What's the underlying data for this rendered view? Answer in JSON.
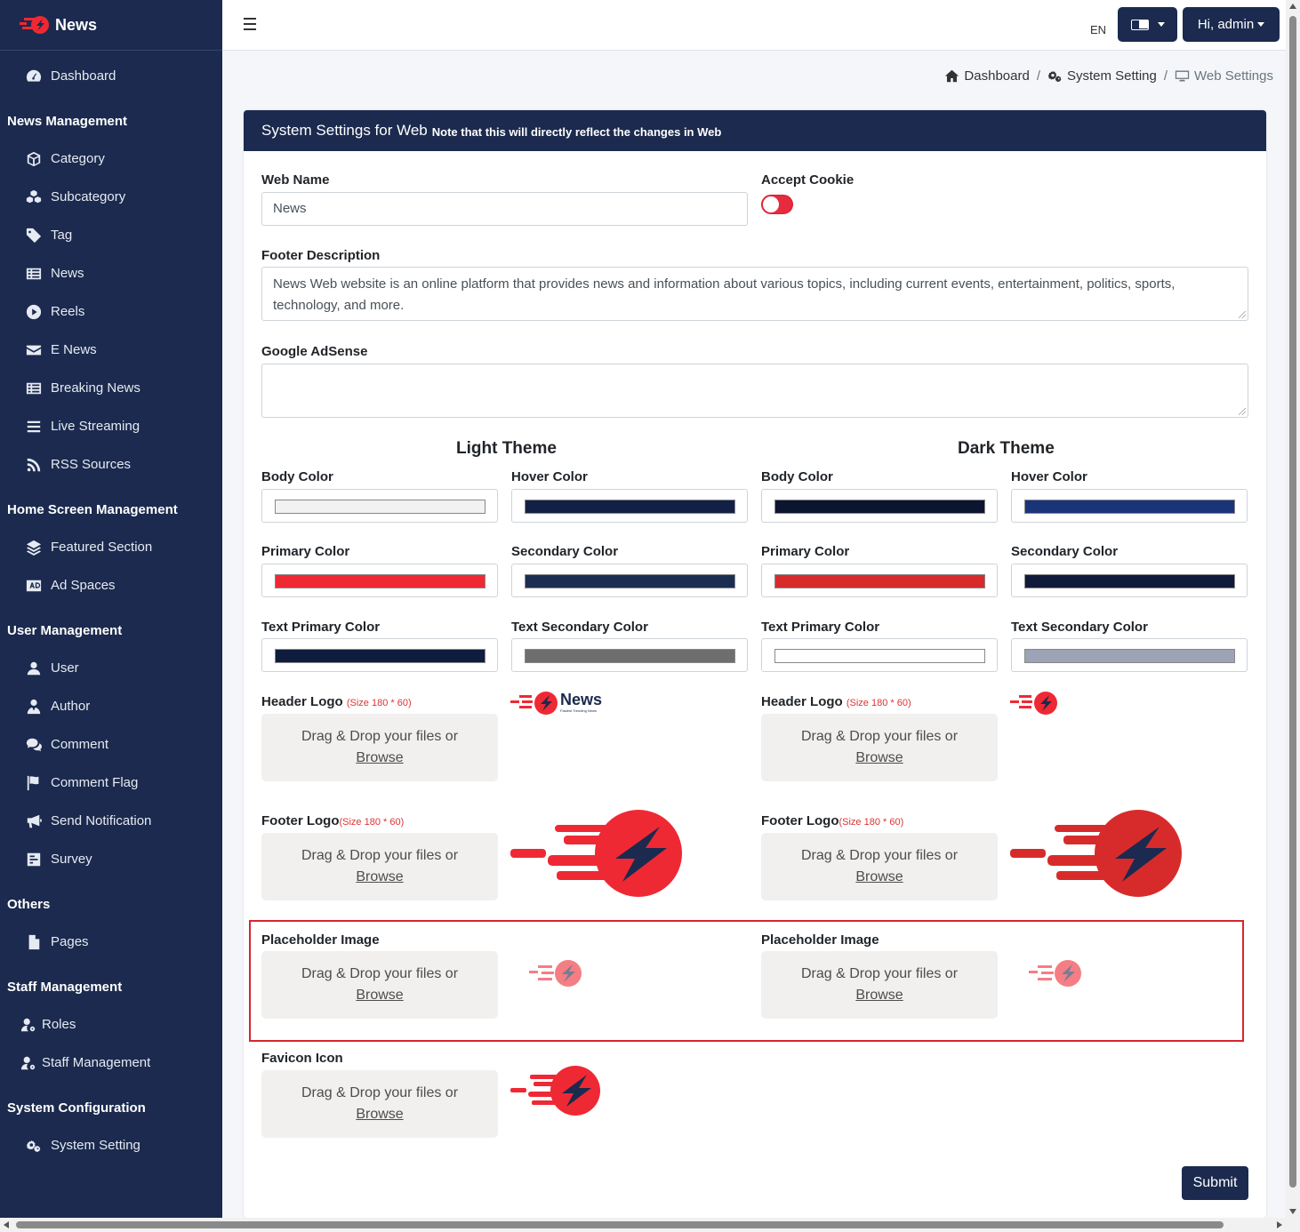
{
  "brand": {
    "name": "News"
  },
  "sidebar": {
    "dashboard": "Dashboard",
    "sections": [
      {
        "title": "News Management",
        "items": [
          "Category",
          "Subcategory",
          "Tag",
          "News",
          "Reels",
          "E News",
          "Breaking News",
          "Live Streaming",
          "RSS Sources"
        ]
      },
      {
        "title": "Home Screen Management",
        "items": [
          "Featured Section",
          "Ad Spaces"
        ]
      },
      {
        "title": "User Management",
        "items": [
          "User",
          "Author",
          "Comment",
          "Comment Flag",
          "Send Notification",
          "Survey"
        ]
      },
      {
        "title": "Others",
        "items": [
          "Pages"
        ]
      },
      {
        "title": "Staff Management",
        "items": [
          "Roles",
          "Staff Management"
        ]
      },
      {
        "title": "System Configuration",
        "items": [
          "System Setting"
        ]
      }
    ]
  },
  "topbar": {
    "lang_code": "EN",
    "user_greeting": "Hi, admin"
  },
  "breadcrumb": {
    "home": "Dashboard",
    "system": "System Setting",
    "current": "Web Settings"
  },
  "card": {
    "title": "System Settings for Web",
    "note": "Note that this will directly reflect the changes in Web"
  },
  "form": {
    "web_name_label": "Web Name",
    "web_name_value": "News",
    "accept_cookie_label": "Accept Cookie",
    "accept_cookie_on": false,
    "footer_desc_label": "Footer Description",
    "footer_desc_value": "News Web website is an online platform that provides news and information about various topics, including current events, entertainment, politics, sports, technology, and more.",
    "adsense_label": "Google AdSense",
    "adsense_value": "",
    "light_theme_title": "Light Theme",
    "dark_theme_title": "Dark Theme",
    "light_colors": [
      {
        "label": "Body Color",
        "value": "#f2f2f2"
      },
      {
        "label": "Hover Color",
        "value": "#122046"
      },
      {
        "label": "Primary Color",
        "value": "#ee2934"
      },
      {
        "label": "Secondary Color",
        "value": "#1b2d51"
      },
      {
        "label": "Text Primary Color",
        "value": "#0e1c3d"
      },
      {
        "label": "Text Secondary Color",
        "value": "#6d6e70"
      }
    ],
    "dark_colors": [
      {
        "label": "Body Color",
        "value": "#0c1530"
      },
      {
        "label": "Hover Color",
        "value": "#1a347a"
      },
      {
        "label": "Primary Color",
        "value": "#d72b2b"
      },
      {
        "label": "Secondary Color",
        "value": "#0f1b39"
      },
      {
        "label": "Text Primary Color",
        "value": "#ffffff"
      },
      {
        "label": "Text Secondary Color",
        "value": "#9ba3b4"
      }
    ],
    "header_logo_label": "Header Logo",
    "header_logo_size": "(Size 180 * 60)",
    "footer_logo_label": "Footer Logo",
    "footer_logo_size": "(Size 180 * 60)",
    "placeholder_label": "Placeholder Image",
    "favicon_label": "Favicon Icon",
    "drop_text": "Drag & Drop your files or",
    "browse_text": "Browse",
    "header_logo_text": "News",
    "header_logo_tagline": "Fastest Trending News",
    "submit_label": "Submit"
  },
  "colors": {
    "sidebar_bg": "#1b2a4e",
    "accent_red": "#ee2934",
    "highlight_border": "#d7262e"
  }
}
